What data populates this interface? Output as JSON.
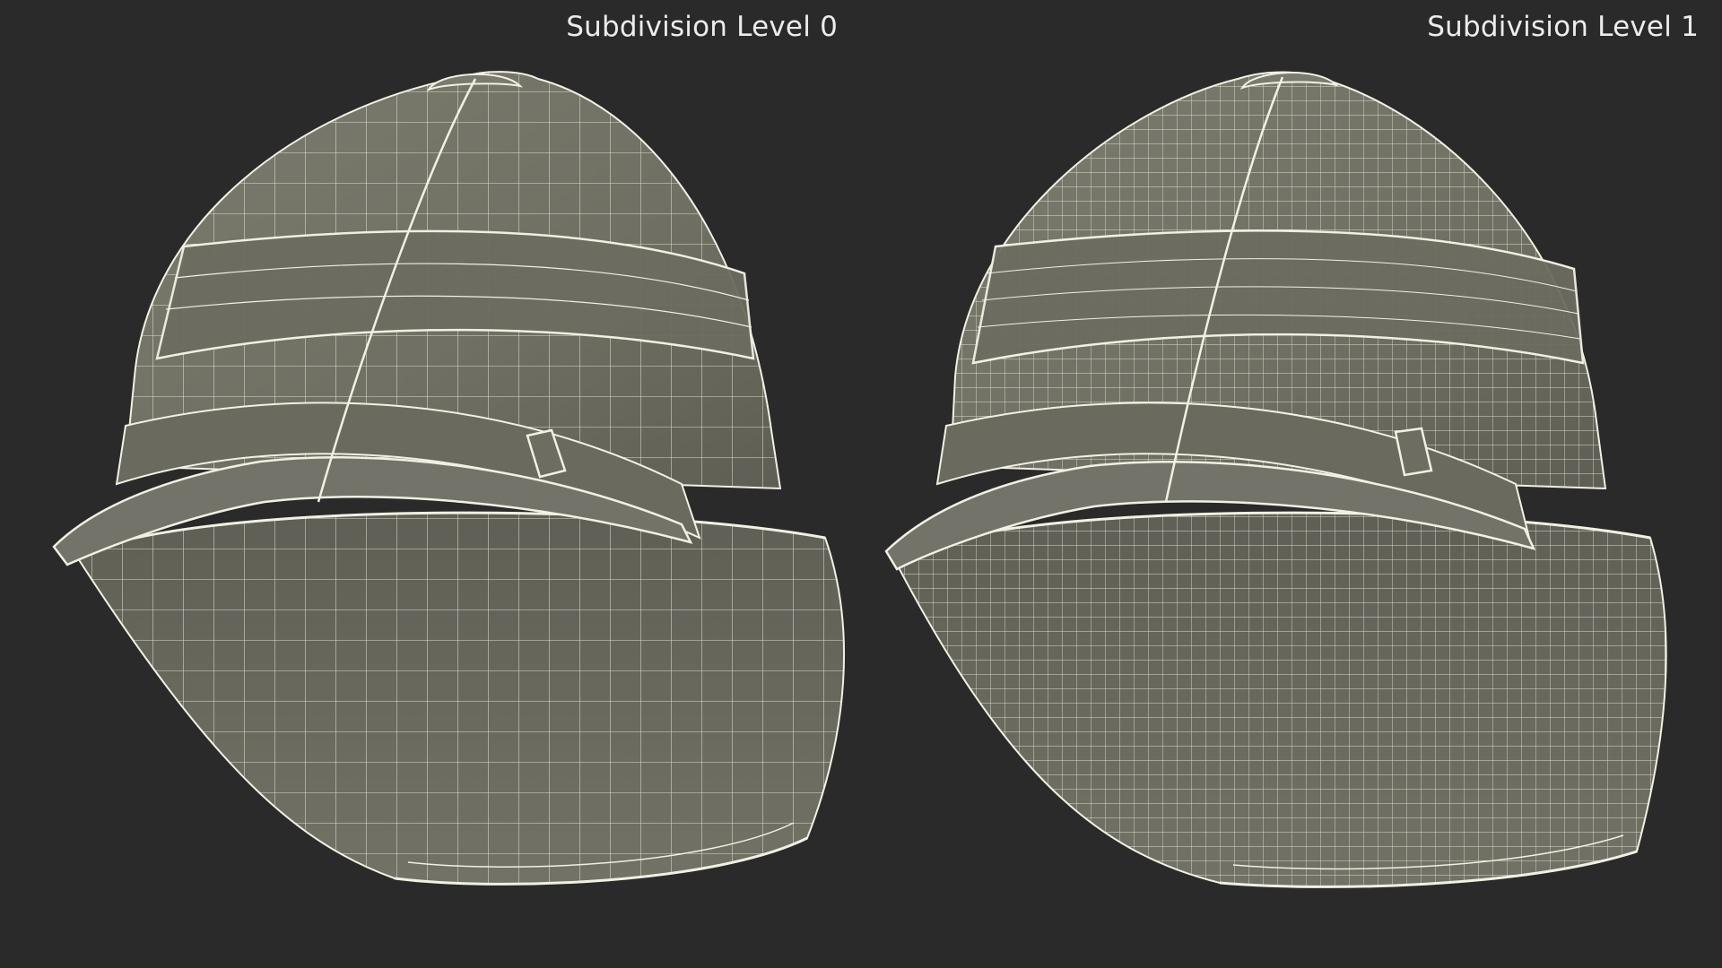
{
  "labels": {
    "left": "Subdivision Level 0",
    "right": "Subdivision Level 1"
  },
  "colors": {
    "background": "#2a2a2a",
    "surface": "#727266",
    "surface_dark": "#5d5d53",
    "interior": "#6e6e63",
    "wire": "#f1f0e2",
    "label_text": "#ececec"
  },
  "models": {
    "left": {
      "subdivision_level": 0,
      "object": "pith helmet wireframe"
    },
    "right": {
      "subdivision_level": 1,
      "object": "pith helmet wireframe"
    }
  }
}
